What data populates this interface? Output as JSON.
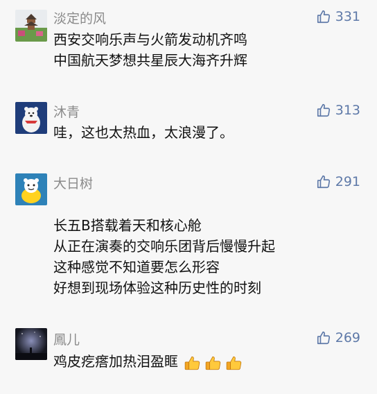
{
  "comments": [
    {
      "username": "淡定的风",
      "likes": "331",
      "avatar_icon": "pagoda-landscape-avatar",
      "lines": [
        "西安交响乐声与火箭发动机齐鸣",
        "中国航天梦想共星辰大海齐升辉"
      ]
    },
    {
      "username": "沐青",
      "likes": "313",
      "avatar_icon": "polar-bear-avatar",
      "lines": [
        "哇，这也太热血，太浪漫了。"
      ]
    },
    {
      "username": "大日树",
      "likes": "291",
      "avatar_icon": "duck-cartoon-avatar",
      "lines": [
        "",
        "长五B搭载着天和核心舱",
        "从正在演奏的交响乐团背后慢慢升起",
        "这种感觉不知道要怎么形容",
        "好想到现场体验这种历史性的时刻"
      ]
    },
    {
      "username": "鳳儿",
      "likes": "269",
      "avatar_icon": "night-sky-avatar",
      "lines": [
        "鸡皮疙瘩加热泪盈眶"
      ],
      "trailing_emoji": [
        "thumbs-up-emoji",
        "thumbs-up-emoji",
        "thumbs-up-emoji"
      ]
    }
  ],
  "colors": {
    "background": "#f7f7f7",
    "username": "#8a8a8a",
    "like": "#5e79a8",
    "text": "#111111"
  }
}
